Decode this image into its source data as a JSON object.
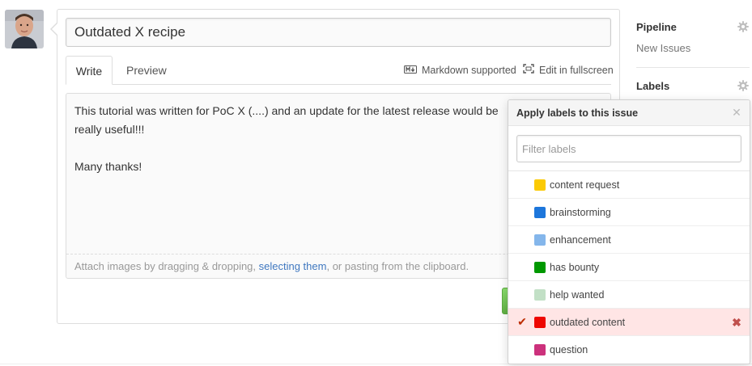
{
  "issue": {
    "title_value": "Outdated X recipe",
    "body_value": "This tutorial was written for PoC X (....) and an update for the latest release would be really useful!!!\n\nMany thanks!"
  },
  "editor": {
    "tabs": [
      {
        "label": "Write",
        "active": true
      },
      {
        "label": "Preview",
        "active": false
      }
    ],
    "markdown_label": "Markdown supported",
    "fullscreen_label": "Edit in fullscreen",
    "attach_prefix": "Attach images by dragging & dropping, ",
    "attach_link": "selecting them",
    "attach_suffix": ", or pasting from the clipboard."
  },
  "sidebar": {
    "pipeline_title": "Pipeline",
    "pipeline_value": "New Issues",
    "labels_title": "Labels"
  },
  "labels_popover": {
    "title": "Apply labels to this issue",
    "filter_placeholder": "Filter labels",
    "labels": [
      {
        "name": "content request",
        "color": "#fbca04",
        "selected": false
      },
      {
        "name": "brainstorming",
        "color": "#1d76db",
        "selected": false
      },
      {
        "name": "enhancement",
        "color": "#84b6eb",
        "selected": false
      },
      {
        "name": "has bounty",
        "color": "#009800",
        "selected": false
      },
      {
        "name": "help wanted",
        "color": "#c2e0c6",
        "selected": false
      },
      {
        "name": "outdated content",
        "color": "#ee0701",
        "selected": true
      },
      {
        "name": "question",
        "color": "#cc317c",
        "selected": false
      }
    ]
  },
  "icons": {
    "check": "check-icon",
    "remove": "close-icon",
    "gear": "gear-icon",
    "markdown": "markdown-icon",
    "fullscreen": "fullscreen-icon"
  },
  "colors": {
    "link": "#4078c0",
    "submit_green": "#6cc644",
    "selected_row": "#ffe5e5"
  }
}
